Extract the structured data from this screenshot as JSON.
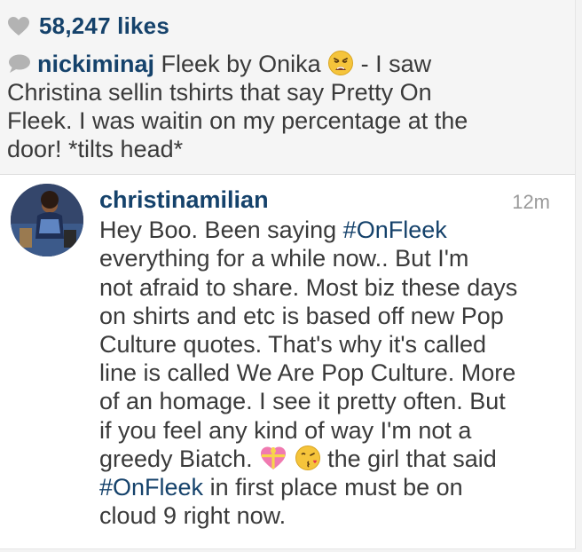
{
  "post": {
    "likes": "58,247 likes",
    "caption": {
      "username": "nickiminaj",
      "lines": [
        " Fleek by Onika ",
        " - I saw",
        "Christina sellin tshirts that say Pretty On",
        "Fleek. I was waitin on my percentage at the",
        "door! *tilts head*"
      ]
    }
  },
  "comment": {
    "username": "christinamilian",
    "timestamp": "12m",
    "lines": {
      "l1_pre": "Hey Boo. Been saying ",
      "l1_tag": "#OnFleek",
      "l2": "everything  for a while now.. But I'm",
      "l3": "not afraid to share. Most biz these days",
      "l4": "on shirts and etc is based off new Pop",
      "l5": "Culture quotes. That's why it's called",
      "l6": "line is called We Are Pop Culture. More",
      "l7": "of an homage. I see it pretty often. But",
      "l8": "if you feel any kind of way I'm not a",
      "l9_pre": "greedy Biatch. ",
      "l9_post": " the girl that said",
      "l10_tag": "#OnFleek",
      "l10_post": " in first place must be on",
      "l11": "cloud 9 right now."
    }
  },
  "icons": {
    "likes": "heart-icon",
    "caption": "speech-bubble-icon",
    "emoji_caption": "weary-face-emoji",
    "emoji_gift": "heart-gift-emoji",
    "emoji_kiss": "kissing-face-emoji"
  },
  "colors": {
    "username": "#15426b",
    "text": "#3a3a3a",
    "timestamp": "#9a9a9a",
    "icon": "#b0b0b0"
  }
}
